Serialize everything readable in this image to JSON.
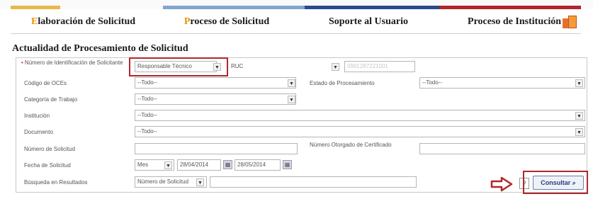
{
  "tabs": [
    {
      "first": "E",
      "rest": "laboración de Solicitud"
    },
    {
      "first": "P",
      "rest": "roceso de Solicitud"
    },
    {
      "first": "",
      "rest": "Soporte al Usuario"
    },
    {
      "first": "",
      "rest": "Proceso de Institución"
    }
  ],
  "page_title": "Actualidad de Procesamiento de Solicitud",
  "form": {
    "id_label": "Número de Identificación de Solicitante",
    "id_type": "Responsable Técnico",
    "id_doc_type": "RUC",
    "id_value": "0991287221001",
    "oce_label": "Código de OCEs",
    "oce_value": "--Todo--",
    "estado_label": "Estado de Procesamiento",
    "estado_value": "--Todo--",
    "categoria_label": "Categoría de Trabajo",
    "categoria_value": "--Todo--",
    "institucion_label": "Institución",
    "institucion_value": "--Todo--",
    "documento_label": "Documento",
    "documento_value": "--Todo--",
    "num_solicitud_label": "Número de Solicitud",
    "num_otorgado_label": "Número Otorgado de Certificado",
    "fecha_label": "Fecha de Solicitud",
    "fecha_period": "Mes",
    "fecha_from": "28/04/2014",
    "fecha_to": "28/05/2014",
    "busqueda_label": "Búsqueda en Resultados",
    "busqueda_type": "Número de Solicitud"
  },
  "consultar_label": "Consultar",
  "help_label": "?",
  "colors": {
    "accent": "#e99400",
    "highlight": "#b0272d",
    "border": "#c8c8c8"
  }
}
